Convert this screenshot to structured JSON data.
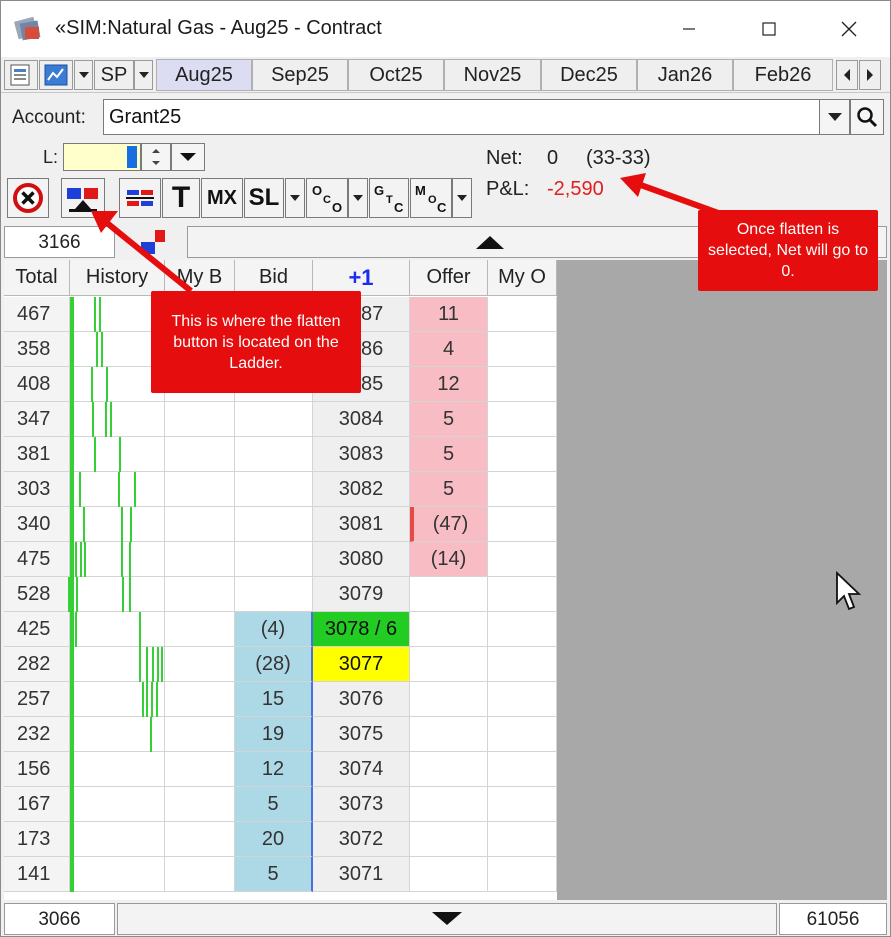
{
  "window": {
    "title": "«SIM:Natural Gas - Aug25 - Contract",
    "controls": [
      "minimize",
      "maximize",
      "close"
    ]
  },
  "toolbar": {
    "sp_label": "SP",
    "tabs": [
      {
        "label": "Aug25",
        "active": true
      },
      {
        "label": "Sep25",
        "active": false
      },
      {
        "label": "Oct25",
        "active": false
      },
      {
        "label": "Nov25",
        "active": false
      },
      {
        "label": "Dec25",
        "active": false
      },
      {
        "label": "Jan26",
        "active": false
      },
      {
        "label": "Feb26",
        "active": false
      }
    ]
  },
  "account": {
    "label": "Account:",
    "value": "Grant25"
  },
  "quantity": {
    "label": "L:",
    "value": ""
  },
  "position": {
    "net_label": "Net:",
    "net_value": "0",
    "net_detail": "(33-33)",
    "pnl_label": "P&L:",
    "pnl_value": "-2,590"
  },
  "order_buttons": {
    "t_label": "T",
    "mx_label": "MX",
    "sl_label": "SL"
  },
  "ladder": {
    "top_price": "3166",
    "bottom_left": "3066",
    "bottom_right": "61056",
    "headers": {
      "total": "Total",
      "history": "History",
      "my_bid": "My B",
      "bid": "Bid",
      "price": "+1",
      "offer": "Offer",
      "my_offer": "My O"
    },
    "rows": [
      {
        "total": "467",
        "bid": "",
        "price": "3087",
        "offer": "11",
        "price_style": "",
        "offer_bar": false
      },
      {
        "total": "358",
        "bid": "",
        "price": "3086",
        "offer": "4",
        "price_style": "",
        "offer_bar": false
      },
      {
        "total": "408",
        "bid": "",
        "price": "3085",
        "offer": "12",
        "price_style": "",
        "offer_bar": false
      },
      {
        "total": "347",
        "bid": "",
        "price": "3084",
        "offer": "5",
        "price_style": "",
        "offer_bar": false
      },
      {
        "total": "381",
        "bid": "",
        "price": "3083",
        "offer": "5",
        "price_style": "",
        "offer_bar": false
      },
      {
        "total": "303",
        "bid": "",
        "price": "3082",
        "offer": "5",
        "price_style": "",
        "offer_bar": false
      },
      {
        "total": "340",
        "bid": "",
        "price": "3081",
        "offer": "(47)",
        "price_style": "",
        "offer_bar": true
      },
      {
        "total": "475",
        "bid": "",
        "price": "3080",
        "offer": "(14)",
        "price_style": "",
        "offer_bar": false
      },
      {
        "total": "528",
        "bid": "",
        "price": "3079",
        "offer": "",
        "price_style": "",
        "offer_bar": false
      },
      {
        "total": "425",
        "bid": "(4)",
        "price": "3078 / 6",
        "offer": "",
        "price_style": "last",
        "offer_bar": false
      },
      {
        "total": "282",
        "bid": "(28)",
        "price": "3077",
        "offer": "",
        "price_style": "current",
        "offer_bar": false
      },
      {
        "total": "257",
        "bid": "15",
        "price": "3076",
        "offer": "",
        "price_style": "",
        "offer_bar": false
      },
      {
        "total": "232",
        "bid": "19",
        "price": "3075",
        "offer": "",
        "price_style": "",
        "offer_bar": false
      },
      {
        "total": "156",
        "bid": "12",
        "price": "3074",
        "offer": "",
        "price_style": "",
        "offer_bar": false
      },
      {
        "total": "167",
        "bid": "5",
        "price": "3073",
        "offer": "",
        "price_style": "",
        "offer_bar": false
      },
      {
        "total": "173",
        "bid": "20",
        "price": "3072",
        "offer": "",
        "price_style": "",
        "offer_bar": false
      },
      {
        "total": "141",
        "bid": "5",
        "price": "3071",
        "offer": "",
        "price_style": "",
        "offer_bar": false
      }
    ]
  },
  "annotations": {
    "flatten_note": "This is where the flatten button is located on the Ladder.",
    "net_note": "Once flatten is selected, Net will go to 0."
  },
  "colors": {
    "offer_bg": "#f7bcc4",
    "bid_bg": "#add8e6",
    "last_trade": "#22cc22",
    "current_price": "#ffff00",
    "pnl_negative": "#e02020",
    "callout": "#e50d0d",
    "history_bar": "#35d035"
  }
}
